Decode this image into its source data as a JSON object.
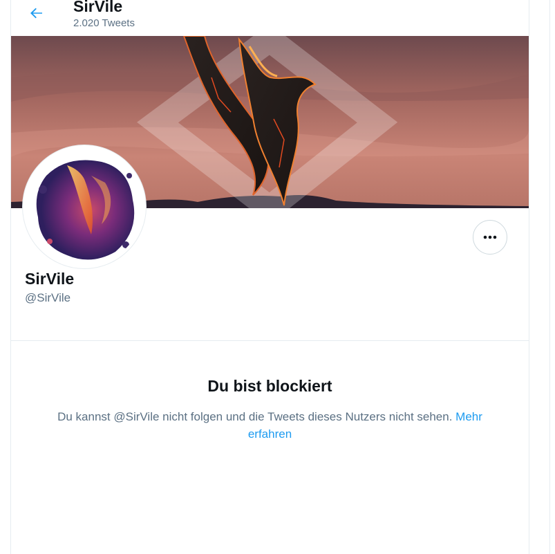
{
  "header": {
    "title": "SirVile",
    "tweet_count": "2.020 Tweets"
  },
  "profile": {
    "name": "SirVile",
    "handle": "@SirVile"
  },
  "blocked": {
    "title": "Du bist blockiert",
    "message": "Du kannst @SirVile nicht folgen und die Tweets dieses Nutzers nicht sehen.",
    "link_label": "Mehr erfahren"
  },
  "icons": {
    "back": "arrow-left-icon",
    "more": "more-dots-icon"
  },
  "colors": {
    "accent": "#1d9bf0",
    "text_primary": "#0f1419",
    "text_secondary": "#5b7083",
    "border": "#e6ecf0"
  }
}
